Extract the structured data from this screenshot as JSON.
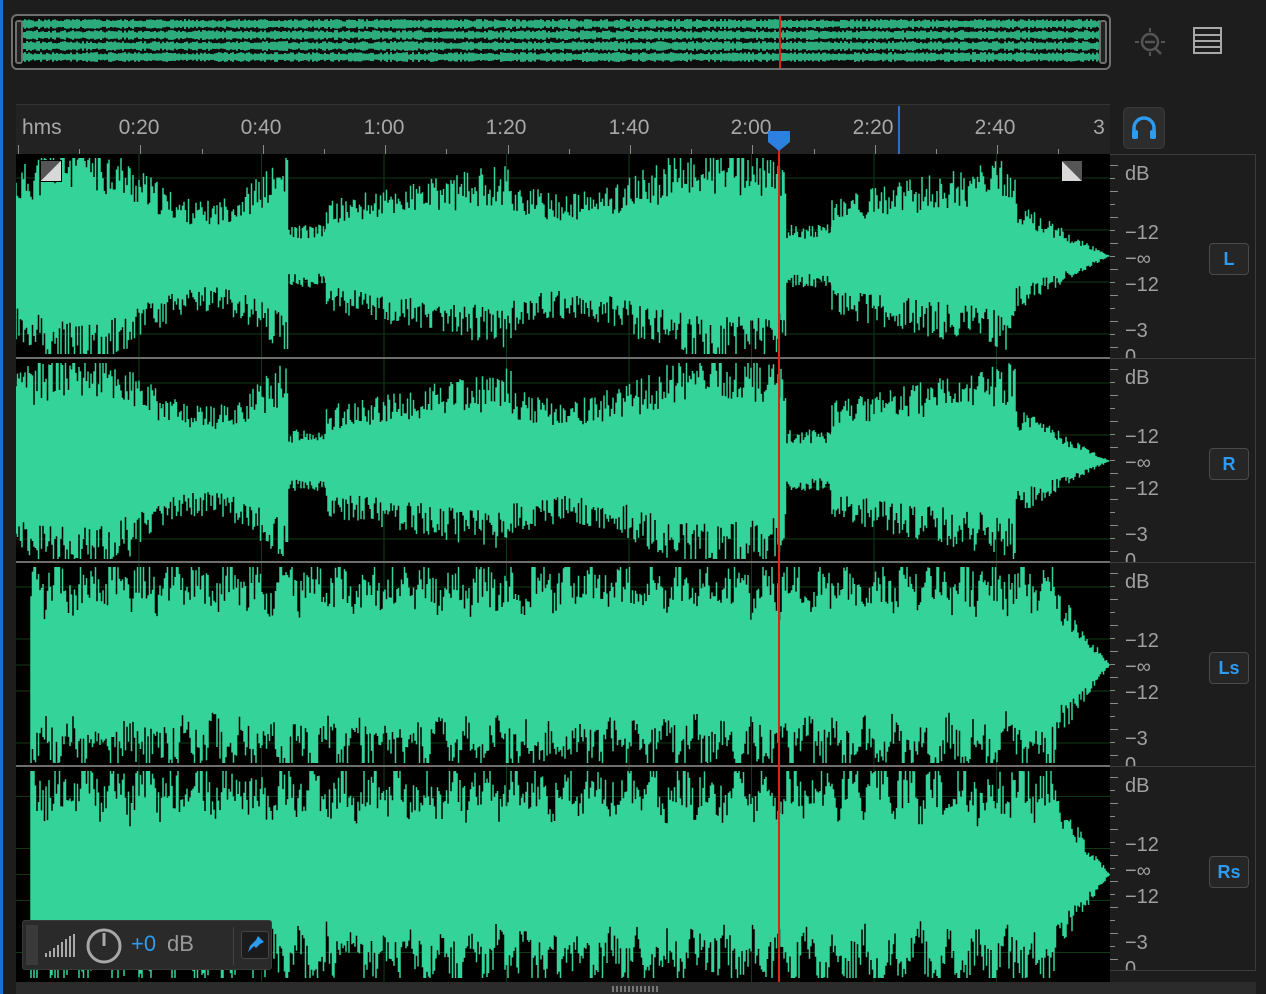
{
  "colors": {
    "waveform": "#34d399",
    "background": "#000000",
    "playhead": "#d9241a",
    "accent": "#2d9bf0",
    "grid": "#0f3a14"
  },
  "overview": {
    "zoom_icon": "zoom-out-icon",
    "list_icon": "list-view-icon"
  },
  "ruler": {
    "unit": "hms",
    "labels": [
      "0:20",
      "0:40",
      "1:00",
      "1:20",
      "1:40",
      "2:00",
      "2:20",
      "2:40",
      "3"
    ]
  },
  "headphone_icon": "headphones-icon",
  "channels": [
    {
      "id": "L",
      "label": "L",
      "scale": [
        "dB",
        "−12",
        "−∞",
        "−12",
        "−3",
        "0"
      ]
    },
    {
      "id": "R",
      "label": "R",
      "scale": [
        "dB",
        "−12",
        "−∞",
        "−12",
        "−3",
        "0"
      ]
    },
    {
      "id": "Ls",
      "label": "Ls",
      "scale": [
        "dB",
        "−12",
        "−∞",
        "−12",
        "−3",
        "0"
      ]
    },
    {
      "id": "Rs",
      "label": "Rs",
      "scale": [
        "dB",
        "−12",
        "−∞",
        "−12",
        "−3",
        "0"
      ]
    }
  ],
  "gain": {
    "value": "+0",
    "unit": "dB",
    "meter_icon": "level-meter-icon",
    "knob_icon": "volume-knob-icon",
    "pin_icon": "pin-icon"
  }
}
